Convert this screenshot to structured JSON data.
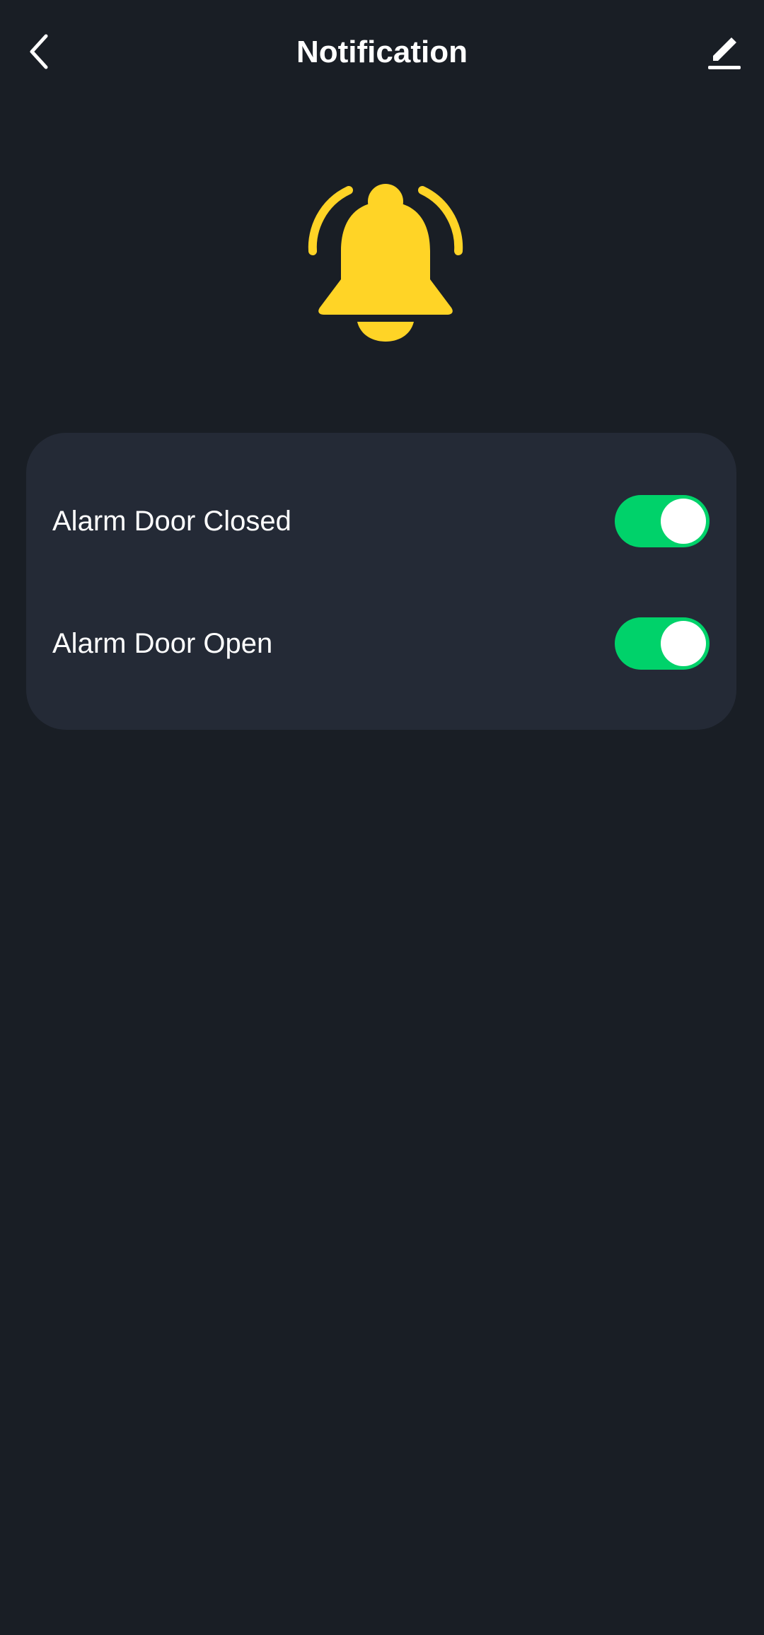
{
  "header": {
    "title": "Notification",
    "back_icon": "chevron-left-icon",
    "edit_icon": "pencil-icon"
  },
  "hero": {
    "icon": "bell-ringing-icon",
    "color": "#FFD426"
  },
  "settings": {
    "items": [
      {
        "label": "Alarm Door Closed",
        "enabled": true
      },
      {
        "label": "Alarm Door Open",
        "enabled": true
      }
    ],
    "toggle_on_color": "#00D26A"
  }
}
